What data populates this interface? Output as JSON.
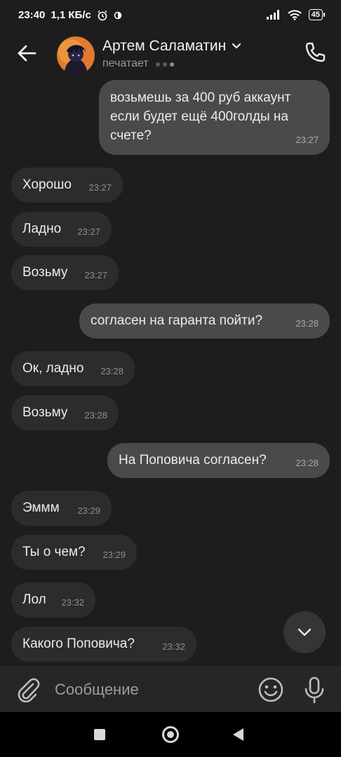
{
  "status_bar": {
    "time": "23:40",
    "net_speed": "1,1 КБ/с",
    "battery": "45"
  },
  "header": {
    "contact_name": "Артем Саламатин",
    "status": "печатает"
  },
  "messages": [
    {
      "dir": "out",
      "text": "возьмешь за 400 руб аккаунт\nесли будет ещё 400голды на\nсчете?",
      "time": "23:27"
    },
    {
      "dir": "in",
      "text": "Хорошо",
      "time": "23:27"
    },
    {
      "dir": "in",
      "text": "Ладно",
      "time": "23:27"
    },
    {
      "dir": "in",
      "text": "Возьму",
      "time": "23:27"
    },
    {
      "dir": "out",
      "text": "согласен на гаранта пойти?",
      "time": "23:28"
    },
    {
      "dir": "in",
      "text": "Ок, ладно",
      "time": "23:28"
    },
    {
      "dir": "in",
      "text": "Возьму",
      "time": "23:28"
    },
    {
      "dir": "out",
      "text": "На Поповича согласен?",
      "time": "23:28"
    },
    {
      "dir": "in",
      "text": "Эммм",
      "time": "23:29"
    },
    {
      "dir": "in",
      "text": "Ты о чем?",
      "time": "23:29"
    },
    {
      "dir": "in",
      "text": "Лол",
      "time": "23:32"
    },
    {
      "dir": "in",
      "text": "Какого Поповича?",
      "time": "23:32"
    }
  ],
  "composer": {
    "placeholder": "Сообщение"
  },
  "icons": {
    "back": "arrow-left-icon",
    "call": "phone-icon",
    "scroll_down": "chevron-down-icon",
    "attach": "paperclip-icon",
    "emoji": "smiley-icon",
    "mic": "microphone-icon"
  },
  "colors": {
    "background": "#1d1d1d",
    "incoming_bubble": "#2c2c2c",
    "outgoing_bubble": "#4a4a4a",
    "composer": "#262626"
  }
}
